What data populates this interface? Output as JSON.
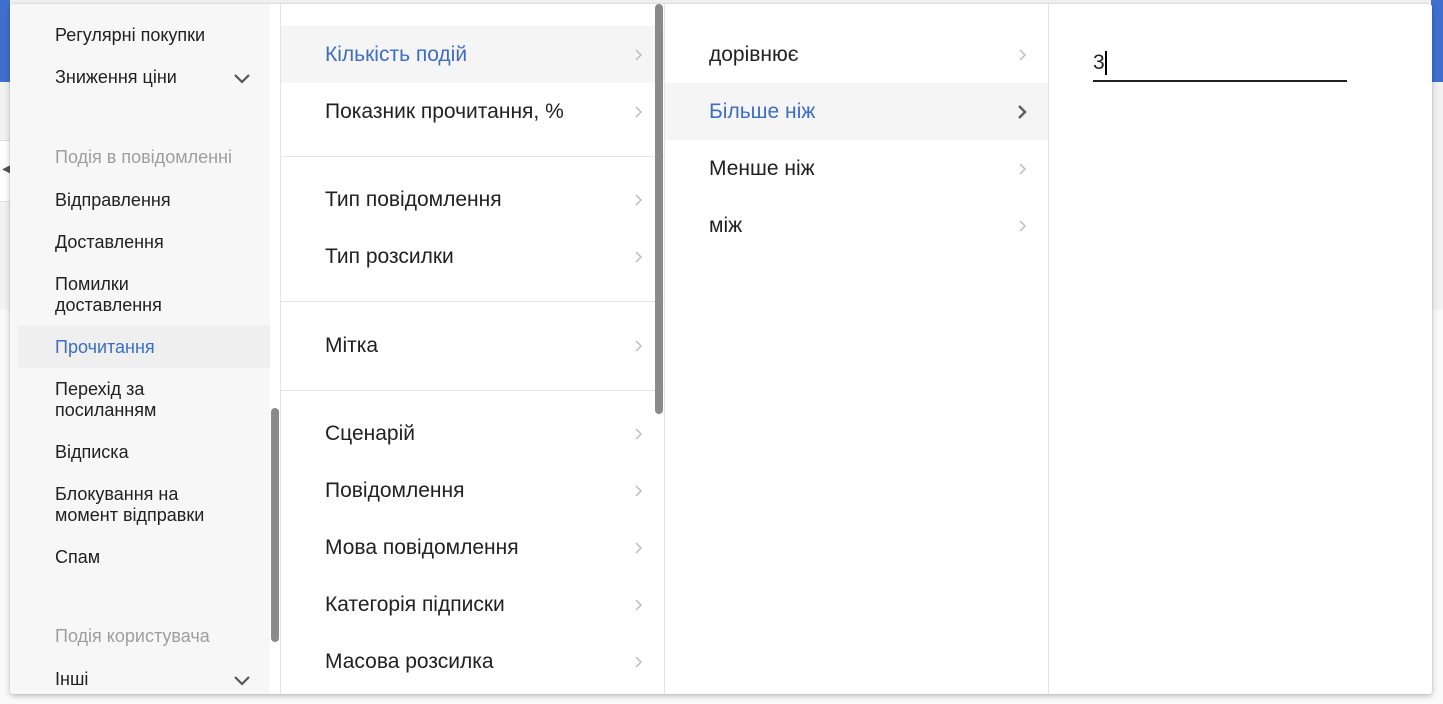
{
  "sidebar": {
    "items": [
      {
        "label": "Регулярні покупки",
        "kind": "item"
      },
      {
        "label": "Зниження ціни",
        "kind": "expandable"
      },
      {
        "label": "Подія в повідомленні",
        "kind": "header"
      },
      {
        "label": "Відправлення",
        "kind": "item"
      },
      {
        "label": "Доставлення",
        "kind": "item"
      },
      {
        "label": "Помилки доставлення",
        "kind": "item"
      },
      {
        "label": "Прочитання",
        "kind": "selected"
      },
      {
        "label": "Перехід за посиланням",
        "kind": "item"
      },
      {
        "label": "Відписка",
        "kind": "item"
      },
      {
        "label": "Блокування на момент відправки",
        "kind": "item"
      },
      {
        "label": "Спам",
        "kind": "item"
      },
      {
        "label": "Подія користувача",
        "kind": "header"
      },
      {
        "label": "Інші",
        "kind": "expandable"
      }
    ]
  },
  "attributes": {
    "items": [
      {
        "label": "Кількість подій",
        "active": true
      },
      {
        "label": "Показник прочитання, %"
      },
      {
        "label": "Тип повідомлення"
      },
      {
        "label": "Тип розсилки"
      },
      {
        "label": "Мітка"
      },
      {
        "label": "Сценарій"
      },
      {
        "label": "Повідомлення"
      },
      {
        "label": "Мова повідомлення"
      },
      {
        "label": "Категорія підписки"
      },
      {
        "label": "Масова розсилка"
      }
    ]
  },
  "operators": {
    "items": [
      {
        "label": "дорівнює"
      },
      {
        "label": "Більше ніж",
        "active": true
      },
      {
        "label": "Менше ніж"
      },
      {
        "label": "між"
      }
    ]
  },
  "value": {
    "current": "3"
  },
  "colors": {
    "accent": "#3d6dc4",
    "header": "#9e9e9e",
    "chevron": "#bdbdbd",
    "chevron_active": "#616161"
  }
}
